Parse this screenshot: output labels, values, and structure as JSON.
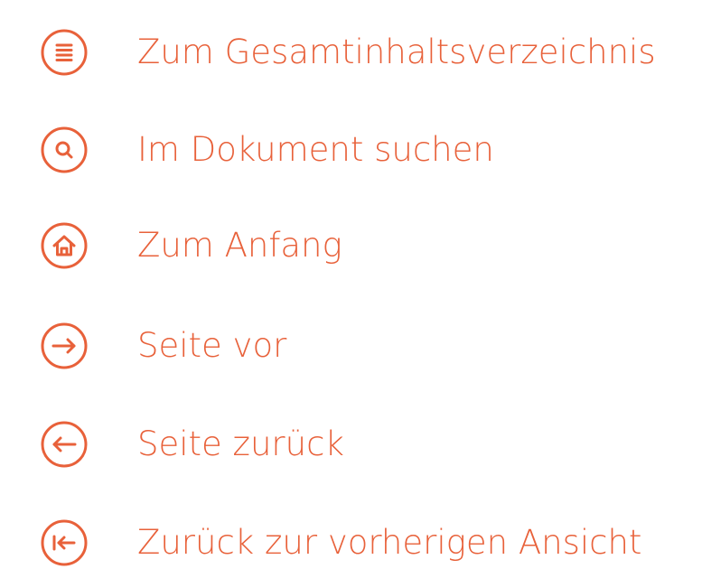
{
  "accent_color": "#e8613a",
  "nav": {
    "items": [
      {
        "label": "Zum Gesamtinhaltsverzeichnis",
        "icon": "toc-list-icon"
      },
      {
        "label": "Im Dokument suchen",
        "icon": "search-icon"
      },
      {
        "label": "Zum Anfang",
        "icon": "home-icon"
      },
      {
        "label": "Seite vor",
        "icon": "arrow-right-icon"
      },
      {
        "label": "Seite zurück",
        "icon": "arrow-left-icon"
      },
      {
        "label": "Zurück zur vorherigen Ansicht",
        "icon": "back-to-previous-view-icon"
      }
    ]
  }
}
